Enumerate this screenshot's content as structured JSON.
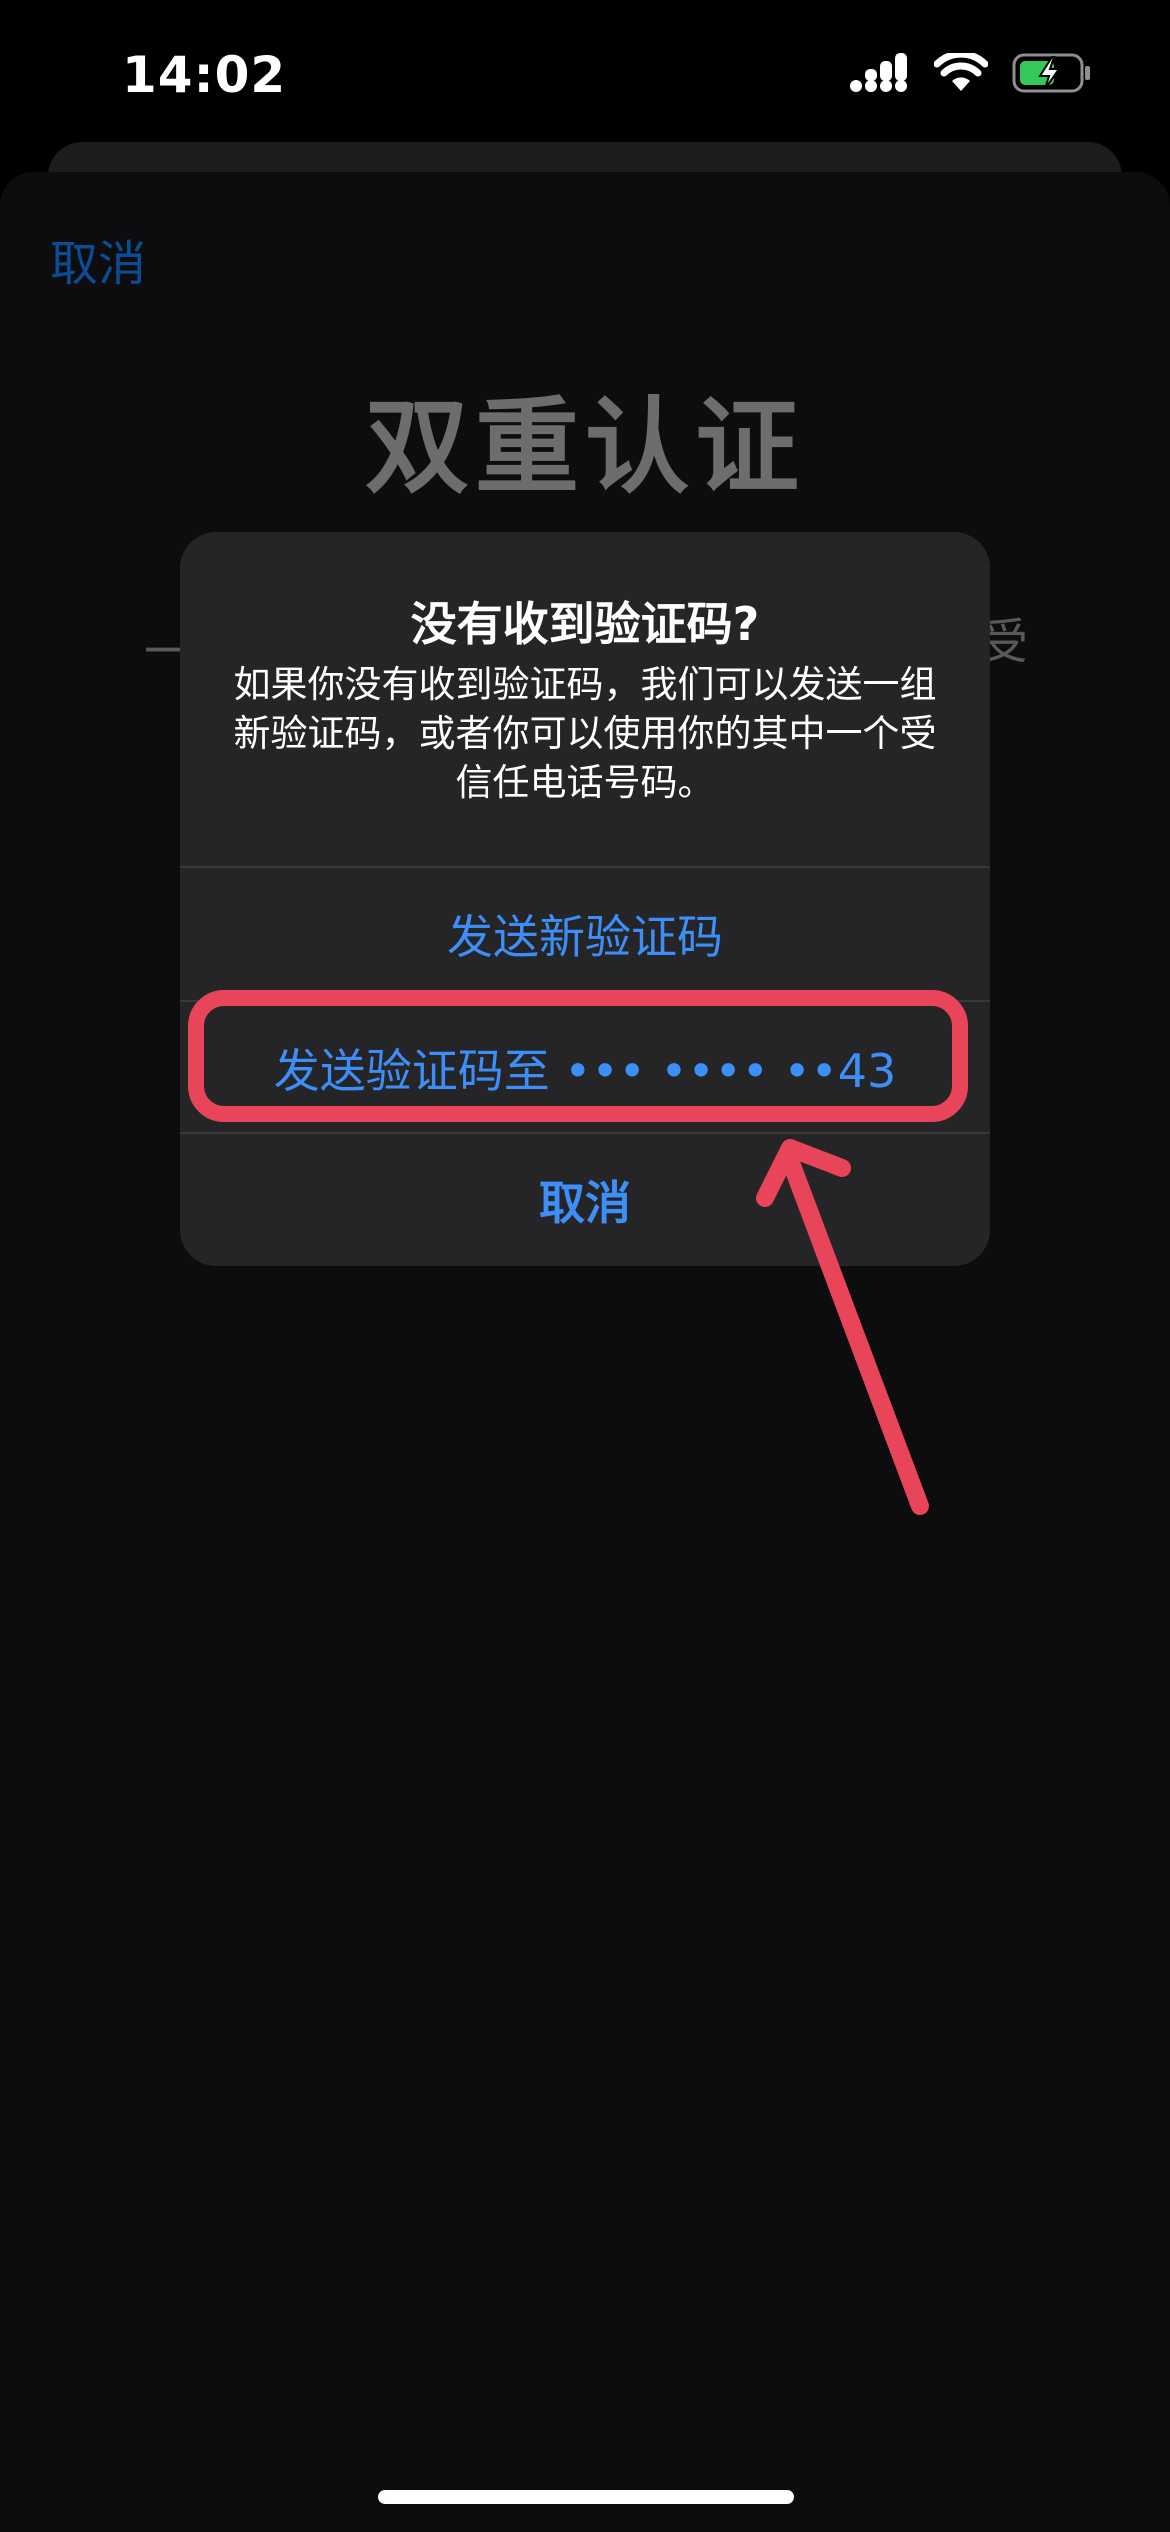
{
  "status_bar": {
    "time": "14:02",
    "icons": [
      "cellular-signal-icon",
      "wifi-icon",
      "battery-charging-icon"
    ]
  },
  "sheet": {
    "cancel_label": "取消",
    "title": "双重认证",
    "subtitle_left_fragment": "一",
    "subtitle_right_fragment": "受"
  },
  "alert": {
    "title": "没有收到验证码?",
    "message": "如果你没有收到验证码，我们可以发送一组新验证码，或者你可以使用你的其中一个受信任电话号码。",
    "buttons": {
      "send_new_code": "发送新验证码",
      "send_to_phone": "发送验证码至 ••• •••• ••43",
      "cancel": "取消"
    }
  },
  "colors": {
    "accent_blue": "#3d8ef7",
    "annotation_red": "#e8455a",
    "alert_background": "#252527",
    "battery_green": "#34c759"
  }
}
